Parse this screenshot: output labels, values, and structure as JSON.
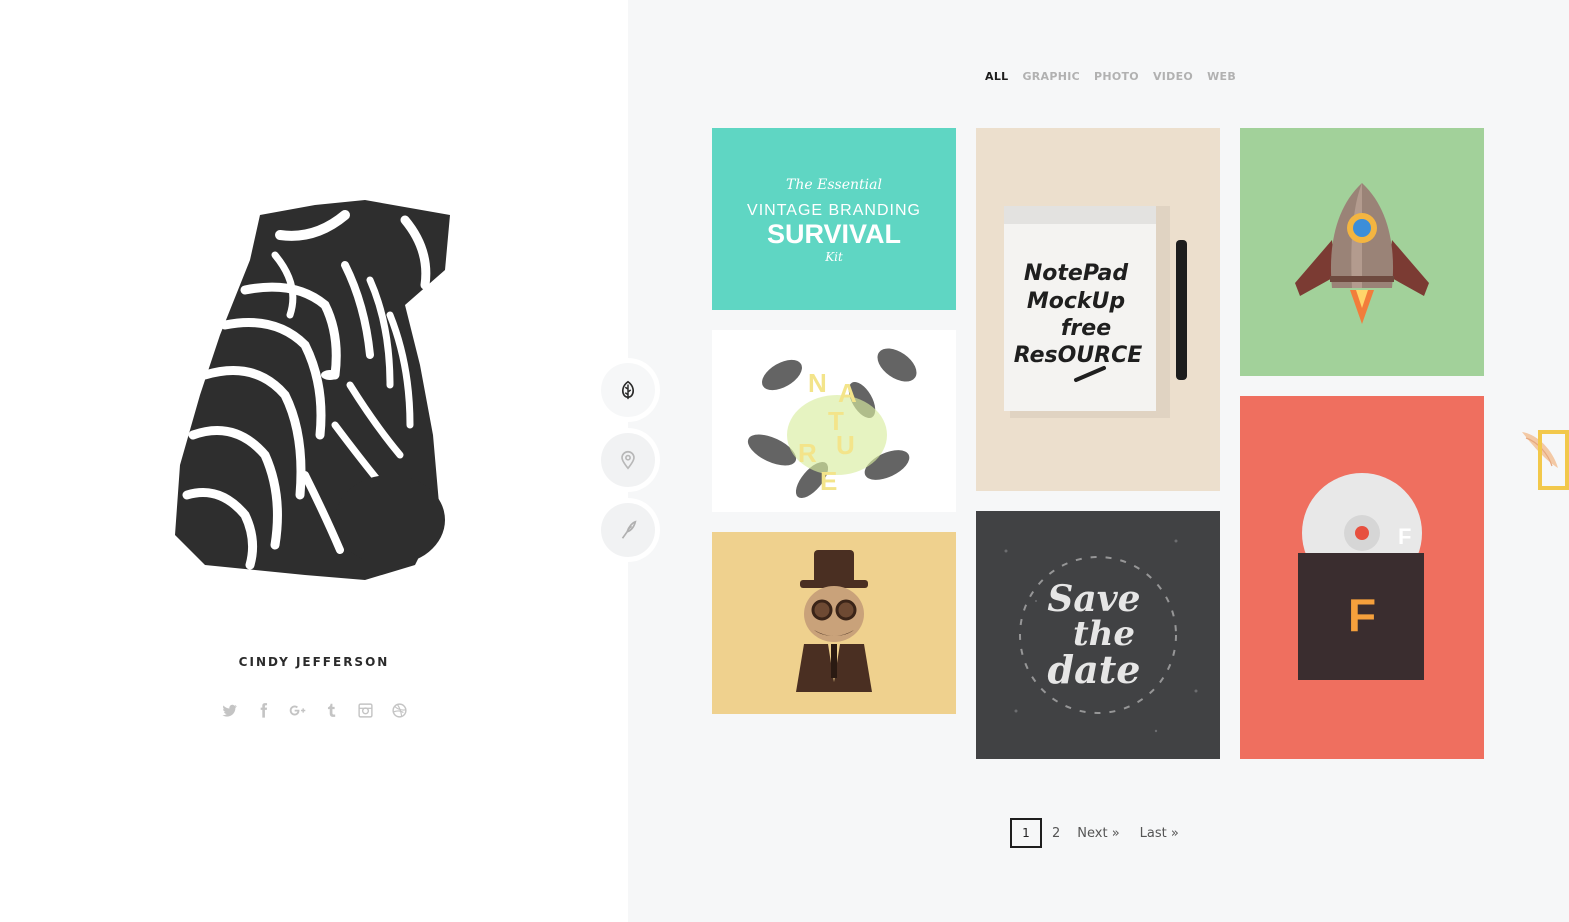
{
  "profile": {
    "name": "CINDY JEFFERSON",
    "social": [
      "twitter-icon",
      "facebook-icon",
      "google-plus-icon",
      "tumblr-icon",
      "instagram-icon",
      "dribbble-icon"
    ]
  },
  "side_tabs": [
    "leaf-icon",
    "map-pin-icon",
    "feather-icon"
  ],
  "filters": {
    "all": "ALL",
    "graphic": "GRAPHIC",
    "photo": "PHOTO",
    "video": "VIDEO",
    "web": "WEB"
  },
  "portfolio": {
    "survival_kit": {
      "bg": "#5fd6c3",
      "line1": "The Essential",
      "line2": "VINTAGE BRANDING",
      "line3": "SURVIVAL",
      "line4": "Kit"
    },
    "notepad": {
      "bg": "#ecdfcd",
      "line1": "NotePad",
      "line2": "MockUp",
      "line3": "free",
      "line4": "ResOURCE"
    },
    "rocket": {
      "bg": "#a2d19a"
    },
    "nature": {
      "bg": "#ffffff",
      "letters": [
        "N",
        "A",
        "T",
        "U",
        "R",
        "E"
      ]
    },
    "steampunk": {
      "bg": "#efd18e"
    },
    "save_date": {
      "bg": "#414244",
      "line1": "Save",
      "line2": "the",
      "line3": "date"
    },
    "f_record": {
      "bg": "#ef6f5f",
      "letter": "F"
    }
  },
  "pagination": {
    "current": "1",
    "page2": "2",
    "next": "Next »",
    "last": "Last »"
  },
  "colors": {
    "left_bg": "#ffffff",
    "right_bg": "#f6f7f8",
    "accent_yellow": "#f2c84b"
  }
}
